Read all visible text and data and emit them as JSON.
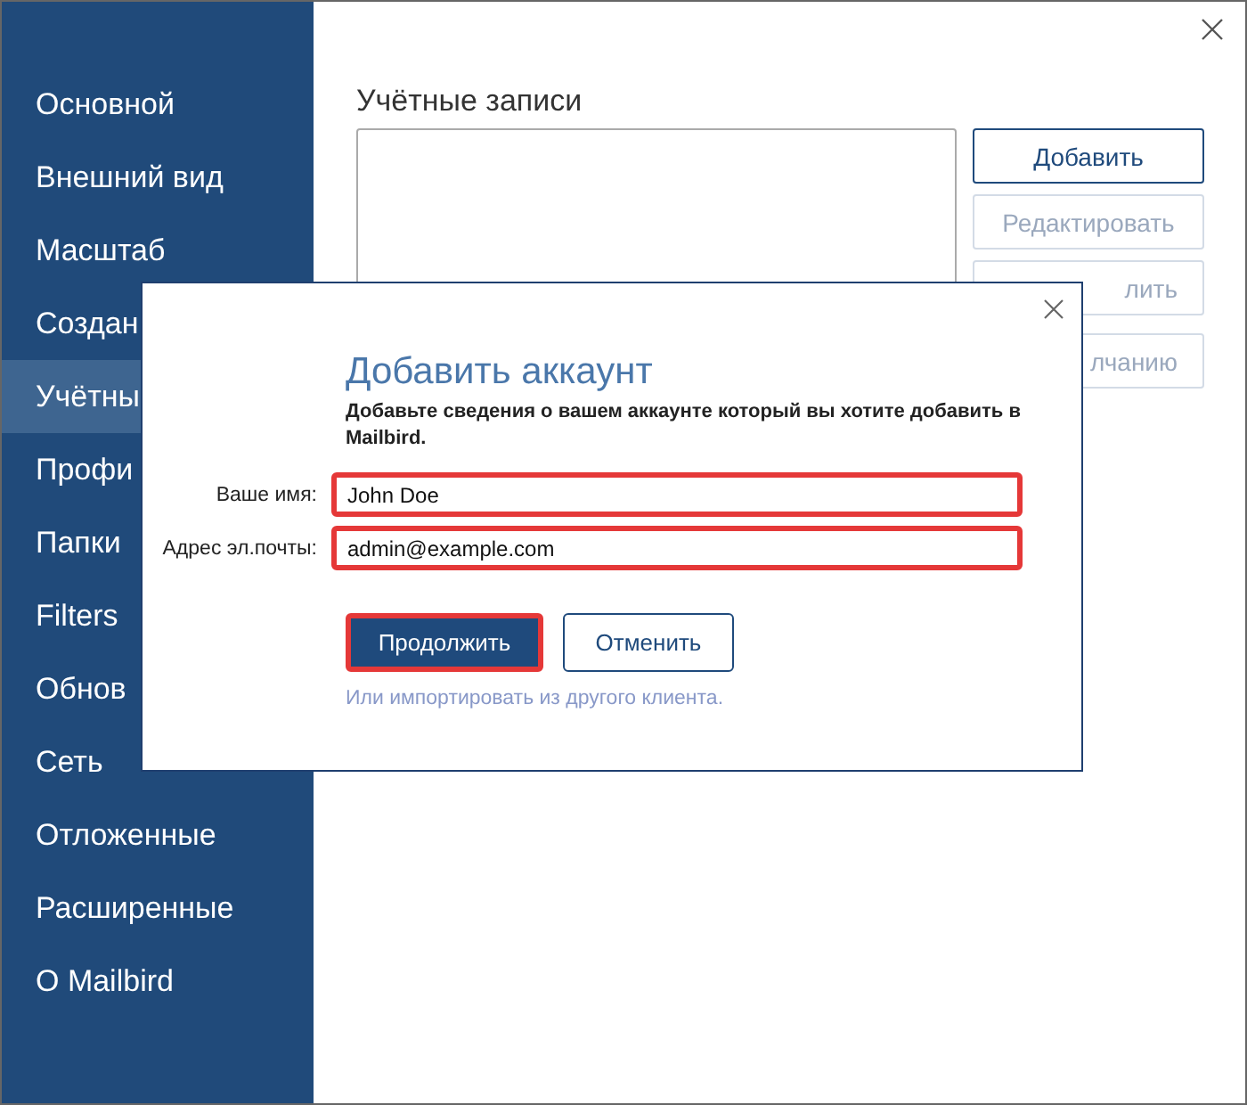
{
  "sidebar": {
    "items": [
      {
        "label": "Основной",
        "selected": false
      },
      {
        "label": "Внешний вид",
        "selected": false
      },
      {
        "label": "Масштаб",
        "selected": false
      },
      {
        "label": "Создан",
        "selected": false
      },
      {
        "label": "Учётны",
        "selected": true
      },
      {
        "label": "Профи",
        "selected": false
      },
      {
        "label": "Папки",
        "selected": false
      },
      {
        "label": "Filters",
        "selected": false
      },
      {
        "label": "Обнов",
        "selected": false
      },
      {
        "label": "Сеть",
        "selected": false
      },
      {
        "label": "Отложенные",
        "selected": false
      },
      {
        "label": "Расширенные",
        "selected": false
      },
      {
        "label": "О Mailbird",
        "selected": false
      }
    ]
  },
  "accounts": {
    "title": "Учётные записи",
    "buttons": [
      {
        "label": "Добавить",
        "disabled": false
      },
      {
        "label": "Редактировать",
        "disabled": true
      },
      {
        "label": "лить",
        "disabled": true
      },
      {
        "label": "лчанию",
        "disabled": true
      }
    ]
  },
  "dialog": {
    "title": "Добавить аккаунт",
    "description": "Добавьте сведения о вашем аккаунте который вы хотите добавить в Mailbird.",
    "fields": [
      {
        "label": "Ваше имя:",
        "value": "John Doe",
        "highlighted": true
      },
      {
        "label": "Адрес эл.почты:",
        "value": "admin@example.com",
        "highlighted": true
      }
    ],
    "buttons": [
      {
        "label": "Продолжить",
        "kind": "primary",
        "highlighted": true
      },
      {
        "label": "Отменить",
        "kind": "secondary",
        "highlighted": false
      }
    ],
    "import_link": "Или импортировать из другого клиента."
  }
}
